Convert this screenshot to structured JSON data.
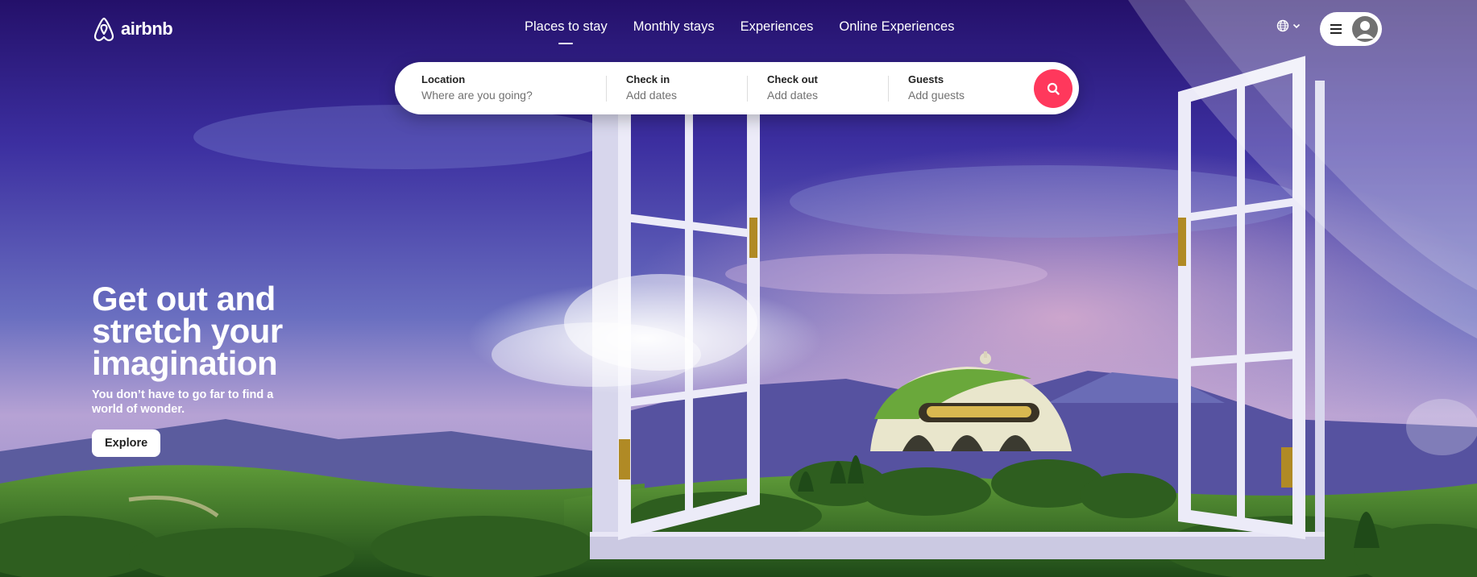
{
  "header": {
    "logo_text": "airbnb",
    "nav": [
      {
        "label": "Places to stay",
        "active": true
      },
      {
        "label": "Monthly stays",
        "active": false
      },
      {
        "label": "Experiences",
        "active": false
      },
      {
        "label": "Online Experiences",
        "active": false
      }
    ],
    "language_icon": "globe-icon",
    "menu_icon": "hamburger-icon",
    "avatar_icon": "user-icon"
  },
  "search": {
    "location": {
      "label": "Location",
      "placeholder": "Where are you going?"
    },
    "check_in": {
      "label": "Check in",
      "placeholder": "Add dates"
    },
    "check_out": {
      "label": "Check out",
      "placeholder": "Add dates"
    },
    "guests": {
      "label": "Guests",
      "placeholder": "Add guests"
    },
    "button_icon": "search-icon",
    "accent_color": "#ff385c"
  },
  "hero": {
    "title": "Get out and stretch your imagination",
    "subtitle": "You don’t have to go far to find a world of wonder.",
    "cta_label": "Explore"
  },
  "colors": {
    "sky_top": "#2b1870",
    "sky_bottom": "#b7a6d8",
    "grass": "#3f7a2a"
  }
}
